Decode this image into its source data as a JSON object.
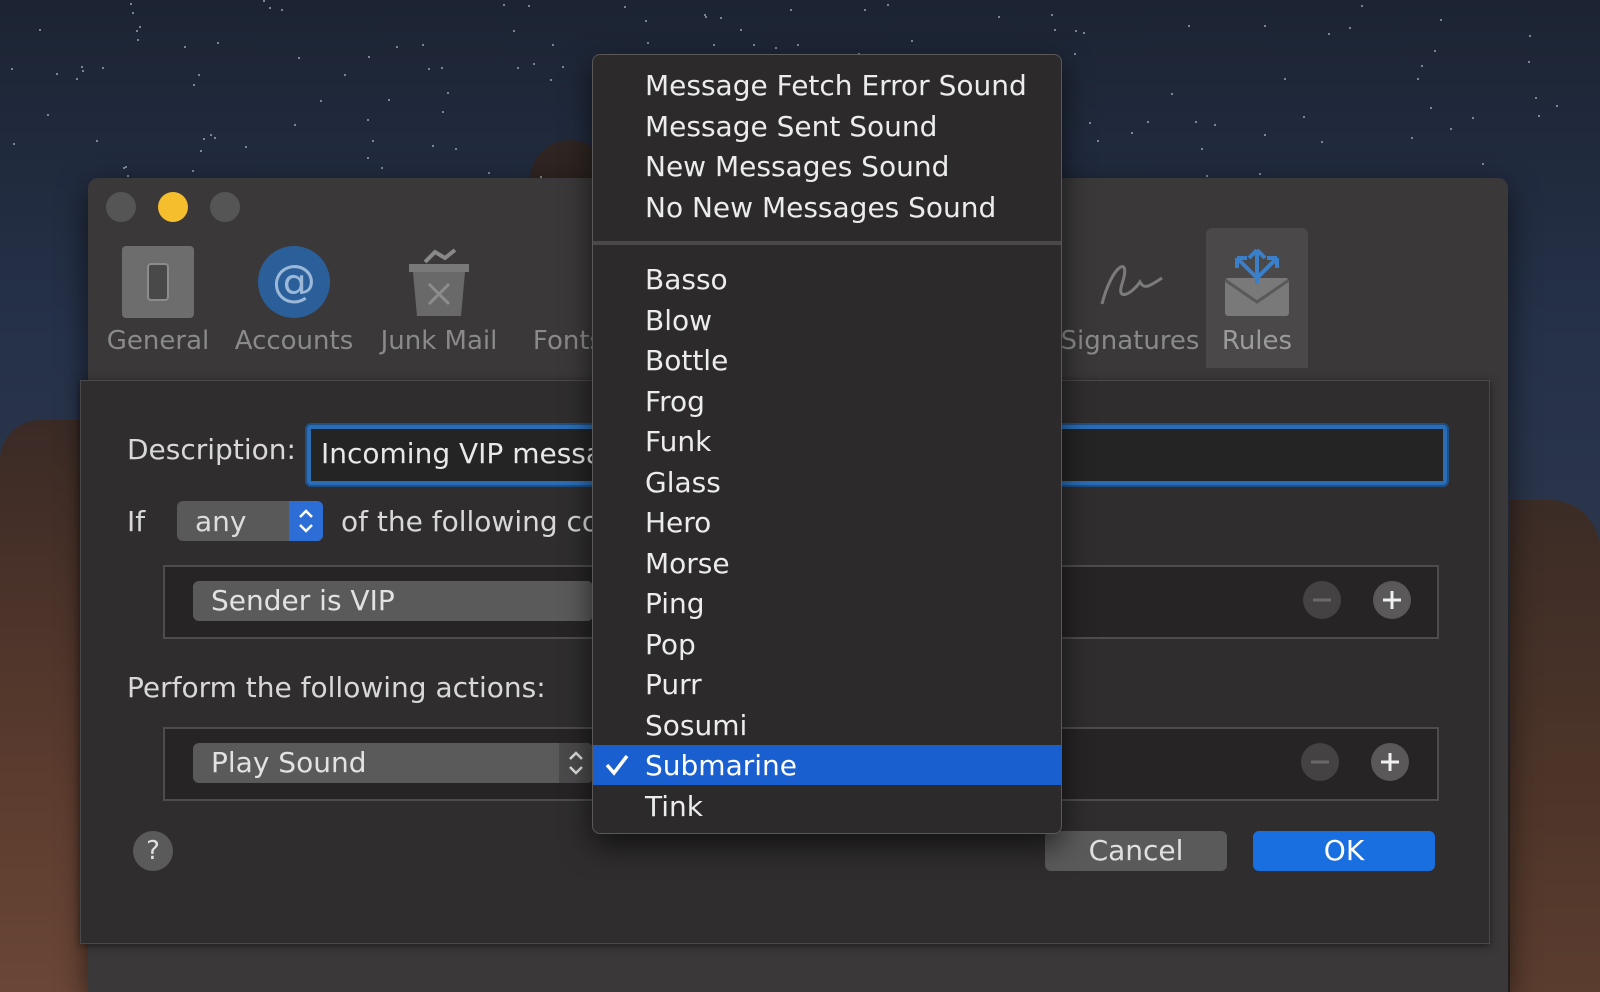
{
  "window": {
    "toolbar": [
      {
        "label": "General"
      },
      {
        "label": "Accounts"
      },
      {
        "label": "Junk Mail"
      },
      {
        "label": "Fonts"
      },
      {
        "label": "Signatures"
      },
      {
        "label": "Rules"
      }
    ]
  },
  "sheet": {
    "description_label": "Description:",
    "description_value": "Incoming VIP messag",
    "if_label": "If",
    "match_value": "any",
    "conditions_text": "of the following co",
    "condition_value": "Sender is VIP",
    "actions_label": "Perform the following actions:",
    "action_value": "Play Sound",
    "help_label": "?",
    "cancel_label": "Cancel",
    "ok_label": "OK"
  },
  "menu": {
    "group1": [
      "Message Fetch Error Sound",
      "Message Sent Sound",
      "New Messages Sound",
      "No New Messages Sound"
    ],
    "group2": [
      "Basso",
      "Blow",
      "Bottle",
      "Frog",
      "Funk",
      "Glass",
      "Hero",
      "Morse",
      "Ping",
      "Pop",
      "Purr",
      "Sosumi",
      "Submarine",
      "Tink"
    ],
    "selected": "Submarine"
  },
  "colors": {
    "accent": "#1a6fe0",
    "menu_selection": "#1a5fd0",
    "traffic_yellow": "#f4be2d"
  }
}
